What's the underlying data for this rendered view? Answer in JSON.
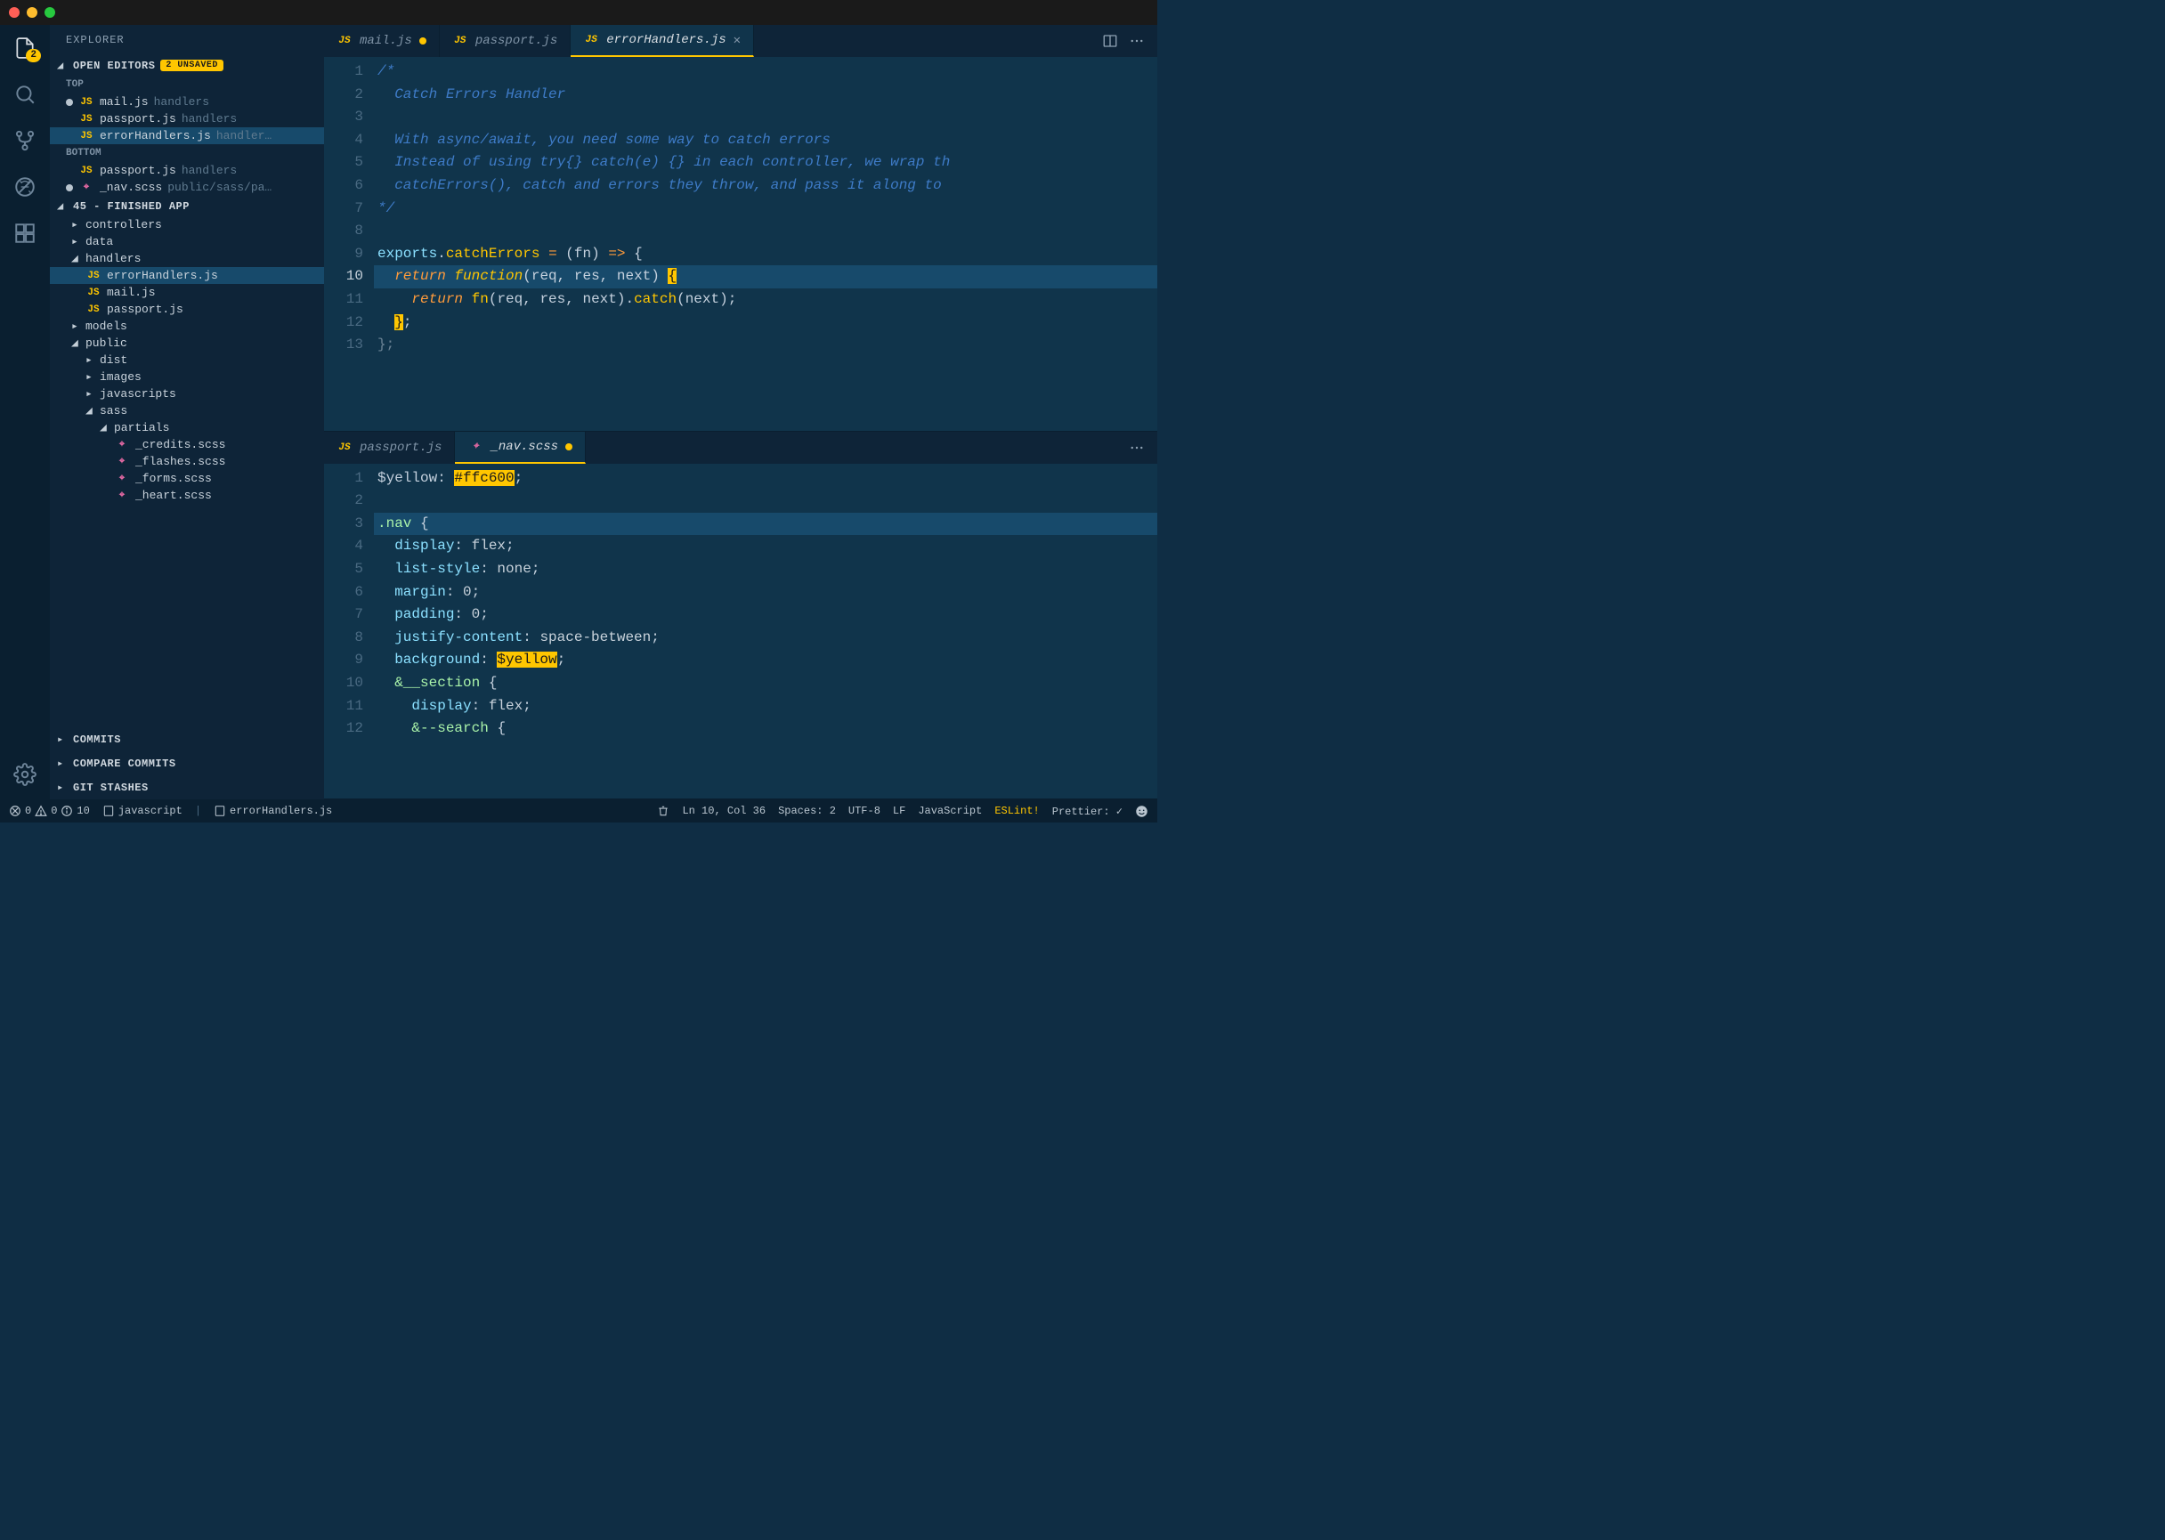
{
  "sidebar": {
    "title": "EXPLORER",
    "openEditorsLabel": "OPEN EDITORS",
    "unsavedBadge": "2 UNSAVED",
    "groups": {
      "top": "TOP",
      "bottom": "BOTTOM"
    },
    "editorsTop": [
      {
        "name": "mail.js",
        "path": "handlers",
        "modified": true,
        "icon": "JS"
      },
      {
        "name": "passport.js",
        "path": "handlers",
        "modified": false,
        "icon": "JS"
      },
      {
        "name": "errorHandlers.js",
        "path": "handler…",
        "modified": false,
        "icon": "JS",
        "selected": true
      }
    ],
    "editorsBottom": [
      {
        "name": "passport.js",
        "path": "handlers",
        "modified": false,
        "icon": "JS"
      },
      {
        "name": "_nav.scss",
        "path": "public/sass/pa…",
        "modified": true,
        "icon": "scss"
      }
    ],
    "project": {
      "name": "45 - FINISHED APP",
      "tree": [
        {
          "type": "folder",
          "name": "controllers",
          "open": false,
          "indent": 1
        },
        {
          "type": "folder",
          "name": "data",
          "open": false,
          "indent": 1
        },
        {
          "type": "folder",
          "name": "handlers",
          "open": true,
          "indent": 1
        },
        {
          "type": "file",
          "name": "errorHandlers.js",
          "icon": "JS",
          "indent": 2,
          "selected": true
        },
        {
          "type": "file",
          "name": "mail.js",
          "icon": "JS",
          "indent": 2
        },
        {
          "type": "file",
          "name": "passport.js",
          "icon": "JS",
          "indent": 2
        },
        {
          "type": "folder",
          "name": "models",
          "open": false,
          "indent": 1
        },
        {
          "type": "folder",
          "name": "public",
          "open": true,
          "indent": 1
        },
        {
          "type": "folder",
          "name": "dist",
          "open": false,
          "indent": 2
        },
        {
          "type": "folder",
          "name": "images",
          "open": false,
          "indent": 2
        },
        {
          "type": "folder",
          "name": "javascripts",
          "open": false,
          "indent": 2
        },
        {
          "type": "folder",
          "name": "sass",
          "open": true,
          "indent": 2
        },
        {
          "type": "folder",
          "name": "partials",
          "open": true,
          "indent": 3
        },
        {
          "type": "file",
          "name": "_credits.scss",
          "icon": "scss",
          "indent": 4
        },
        {
          "type": "file",
          "name": "_flashes.scss",
          "icon": "scss",
          "indent": 4
        },
        {
          "type": "file",
          "name": "_forms.scss",
          "icon": "scss",
          "indent": 4
        },
        {
          "type": "file",
          "name": "_heart.scss",
          "icon": "scss",
          "indent": 4
        }
      ]
    },
    "bottomPanels": [
      "COMMITS",
      "COMPARE COMMITS",
      "GIT STASHES"
    ]
  },
  "activityBadge": "2",
  "tabsTop": [
    {
      "name": "mail.js",
      "icon": "JS",
      "modified": true
    },
    {
      "name": "passport.js",
      "icon": "JS"
    },
    {
      "name": "errorHandlers.js",
      "icon": "JS",
      "active": true,
      "close": true
    }
  ],
  "tabsBottom": [
    {
      "name": "passport.js",
      "icon": "JS"
    },
    {
      "name": "_nav.scss",
      "icon": "scss",
      "active": true,
      "modified": true
    }
  ],
  "editorTop": {
    "lines": [
      1,
      2,
      3,
      4,
      5,
      6,
      7,
      8,
      9,
      10,
      11,
      12,
      13
    ],
    "currentLine": 10
  },
  "codeTop": {
    "l1": "/*",
    "l2": "  Catch Errors Handler",
    "l3": "",
    "l4": "  With async/await, you need some way to catch errors",
    "l5": "  Instead of using try{} catch(e) {} in each controller, we wrap th",
    "l6": "  catchErrors(), catch and errors they throw, and pass it along to ",
    "l7": "*/",
    "kw_return": "return",
    "kw_function": "function",
    "exports": "exports",
    "catchErrors": "catchErrors",
    "fn": "fn",
    "req": "req",
    "res": "res",
    "next": "next",
    "catch": "catch"
  },
  "editorBottom": {
    "lines": [
      1,
      2,
      3,
      4,
      5,
      6,
      7,
      8,
      9,
      10,
      11,
      12
    ]
  },
  "codeBottom": {
    "varYellow": "$yellow",
    "hexYellow": "#ffc600",
    "selNav": ".nav",
    "display": "display",
    "flex": "flex",
    "listStyle": "list-style",
    "none": "none",
    "margin": "margin",
    "zero": "0",
    "padding": "padding",
    "justify": "justify-content",
    "spaceBetween": "space-between",
    "background": "background",
    "ampSection": "&__section",
    "ampSearch": "&--search"
  },
  "status": {
    "errors": "0",
    "warnings": "0",
    "info": "10",
    "lang1": "javascript",
    "file": "errorHandlers.js",
    "lnCol": "Ln 10, Col 36",
    "spaces": "Spaces: 2",
    "enc": "UTF-8",
    "eol": "LF",
    "langMode": "JavaScript",
    "eslint": "ESLint!",
    "prettier": "Prettier: ✓"
  }
}
